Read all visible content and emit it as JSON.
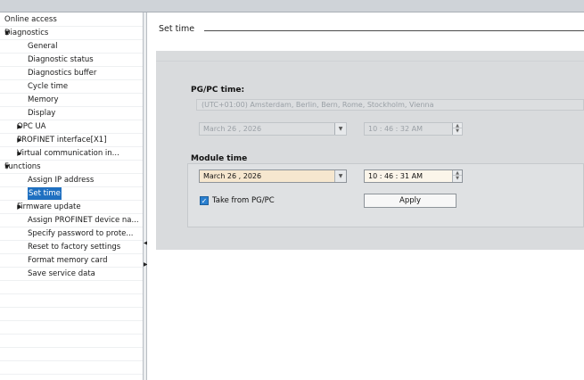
{
  "sidebar": {
    "items": [
      {
        "label": "Online access",
        "level": 0,
        "expander": "",
        "selected": false
      },
      {
        "label": "Diagnostics",
        "level": 0,
        "expander": "down",
        "selected": false
      },
      {
        "label": "General",
        "level": 2,
        "expander": "",
        "selected": false
      },
      {
        "label": "Diagnostic status",
        "level": 2,
        "expander": "",
        "selected": false
      },
      {
        "label": "Diagnostics buffer",
        "level": 2,
        "expander": "",
        "selected": false
      },
      {
        "label": "Cycle time",
        "level": 2,
        "expander": "",
        "selected": false
      },
      {
        "label": "Memory",
        "level": 2,
        "expander": "",
        "selected": false
      },
      {
        "label": "Display",
        "level": 2,
        "expander": "",
        "selected": false
      },
      {
        "label": "OPC UA",
        "level": 1,
        "expander": "right",
        "selected": false
      },
      {
        "label": "PROFINET interface[X1]",
        "level": 1,
        "expander": "right",
        "selected": false
      },
      {
        "label": "Virtual communication in...",
        "level": 1,
        "expander": "right",
        "selected": false
      },
      {
        "label": "Functions",
        "level": 0,
        "expander": "down",
        "selected": false
      },
      {
        "label": "Assign IP address",
        "level": 2,
        "expander": "",
        "selected": false
      },
      {
        "label": "Set time",
        "level": 2,
        "expander": "",
        "selected": true
      },
      {
        "label": "Firmware update",
        "level": 1,
        "expander": "right",
        "selected": false
      },
      {
        "label": "Assign PROFINET device na...",
        "level": 2,
        "expander": "",
        "selected": false
      },
      {
        "label": "Specify password to prote...",
        "level": 2,
        "expander": "",
        "selected": false
      },
      {
        "label": "Reset to factory settings",
        "level": 2,
        "expander": "",
        "selected": false
      },
      {
        "label": "Format memory card",
        "level": 2,
        "expander": "",
        "selected": false
      },
      {
        "label": "Save service data",
        "level": 2,
        "expander": "",
        "selected": false
      },
      {
        "label": "",
        "level": 0,
        "expander": "",
        "selected": false
      },
      {
        "label": "",
        "level": 0,
        "expander": "",
        "selected": false
      },
      {
        "label": "",
        "level": 0,
        "expander": "",
        "selected": false
      },
      {
        "label": "",
        "level": 0,
        "expander": "",
        "selected": false
      },
      {
        "label": "",
        "level": 0,
        "expander": "",
        "selected": false
      },
      {
        "label": "",
        "level": 0,
        "expander": "",
        "selected": false
      },
      {
        "label": "",
        "level": 0,
        "expander": "",
        "selected": false
      }
    ]
  },
  "main": {
    "section_title": "Set time",
    "pgpc": {
      "label": "PG/PC time:",
      "timezone": "(UTC+01:00) Amsterdam, Berlin, Bern, Rome, Stockholm, Vienna",
      "date": "March  26 ,  2026",
      "time": "10 : 46 : 32    AM"
    },
    "module": {
      "label": "Module time",
      "date": "March  26 ,  2026",
      "time": "10 : 46 : 31    AM",
      "take_from_pgpc_label": "Take from PG/PC",
      "take_from_pgpc_checked": true,
      "apply_label": "Apply"
    }
  },
  "colors": {
    "selection": "#1f70c1",
    "panel": "#d9dbdd",
    "active_field": "#f6e7cf",
    "checkbox": "#2a7fcf"
  },
  "icons": {
    "expand": "triangle-down-icon",
    "collapse": "triangle-right-icon",
    "dropdown": "dropdown-arrow-icon",
    "spinner": "spinner-arrows-icon",
    "checkmark": "check-icon"
  }
}
